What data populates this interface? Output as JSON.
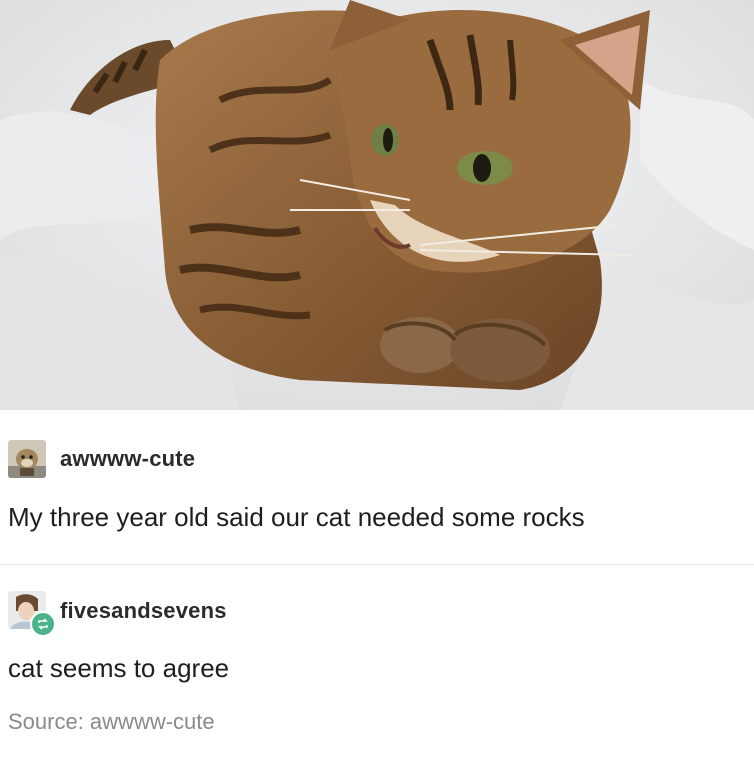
{
  "photo": {
    "subject": "tabby cat lying on white bedsheet"
  },
  "post1": {
    "username": "awwww-cute",
    "avatar_icon": "dog-avatar-icon",
    "text": "My three year old said our cat needed some rocks"
  },
  "post2": {
    "username": "fivesandsevens",
    "avatar_icon": "person-avatar-icon",
    "badge_icon": "reblog-icon",
    "text": "cat seems to agree",
    "source": "Source: awwww-cute"
  },
  "colors": {
    "badge": "#4bb38a",
    "source_text": "#8a8a8a"
  }
}
